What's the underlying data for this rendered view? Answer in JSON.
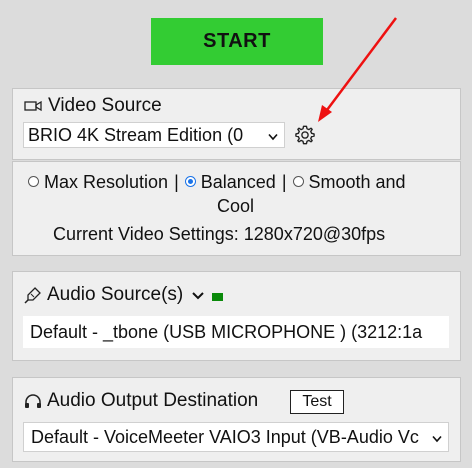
{
  "start_button": {
    "label": "START",
    "color": "#33cc33"
  },
  "video": {
    "heading": "Video Source",
    "icon": "video-camera-icon",
    "selected_device": "BRIO 4K Stream Edition (0",
    "settings_icon": "gear-icon"
  },
  "annotation": {
    "arrow_color": "#ee1111"
  },
  "quality": {
    "options": [
      {
        "label": "Max Resolution",
        "checked": false
      },
      {
        "label": "Balanced",
        "checked": true
      },
      {
        "label": "Smooth and Cool",
        "checked": false
      }
    ],
    "option_sep": "|",
    "option3_line1": "Smooth and",
    "option3_line2": "Cool",
    "current_settings": "Current Video Settings: 1280x720@30fps"
  },
  "audio": {
    "heading": "Audio Source(s)",
    "icon": "microphone-icon",
    "level_color": "#0a8a0a",
    "selected_device": "Default - _tbone (USB MICROPHONE ) (3212:1a"
  },
  "output": {
    "heading": "Audio Output Destination",
    "icon": "headphones-icon",
    "test_label": "Test",
    "selected_device": "Default - VoiceMeeter VAIO3 Input (VB-Audio Vc"
  }
}
